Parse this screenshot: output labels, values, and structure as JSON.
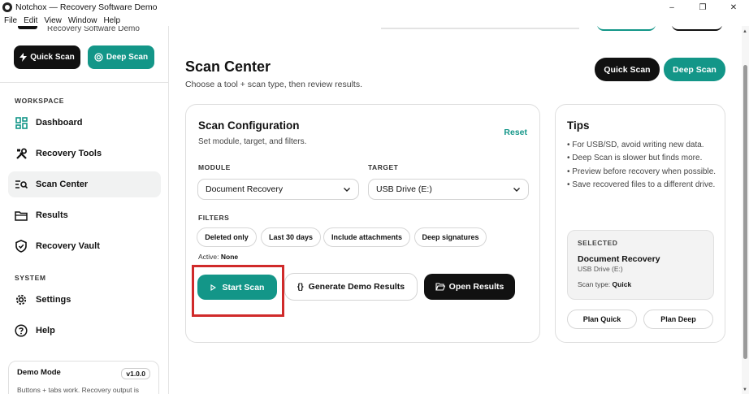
{
  "window": {
    "title": "Notchox — Recovery Software Demo",
    "controls": [
      "–",
      "❐",
      "✕"
    ]
  },
  "menu": [
    "File",
    "Edit",
    "View",
    "Window",
    "Help"
  ],
  "sidebar": {
    "brand_sub": "Recovery Software Demo",
    "quick_label": "Quick Scan",
    "deep_label": "Deep Scan",
    "workspace_label": "WORKSPACE",
    "system_label": "SYSTEM",
    "workspace_items": [
      {
        "label": "Dashboard",
        "icon": "dashboard-icon"
      },
      {
        "label": "Recovery Tools",
        "icon": "tools-icon"
      },
      {
        "label": "Scan Center",
        "icon": "scan-icon",
        "active": true
      },
      {
        "label": "Results",
        "icon": "folder-icon"
      },
      {
        "label": "Recovery Vault",
        "icon": "shield-icon"
      }
    ],
    "system_items": [
      {
        "label": "Settings",
        "icon": "gear-icon"
      },
      {
        "label": "Help",
        "icon": "help-icon"
      }
    ],
    "demo": {
      "title": "Demo Mode",
      "version": "v1.0.0",
      "text": "Buttons + tabs work. Recovery output is"
    }
  },
  "header": {
    "title": "Scan Center",
    "subtitle": "Choose a tool + scan type, then review results.",
    "quick_label": "Quick Scan",
    "deep_label": "Deep Scan"
  },
  "config": {
    "title": "Scan Configuration",
    "subtitle": "Set module, target, and filters.",
    "reset_label": "Reset",
    "module_label": "MODULE",
    "module_value": "Document Recovery",
    "target_label": "TARGET",
    "target_value": "USB Drive (E:)",
    "filters_label": "FILTERS",
    "filters": [
      "Deleted only",
      "Last 30 days",
      "Include attachments",
      "Deep signatures"
    ],
    "active_prefix": "Active:",
    "active_value": "None",
    "start_label": "Start Scan",
    "demo_results_label": "Generate Demo Results",
    "open_results_label": "Open Results"
  },
  "tips": {
    "title": "Tips",
    "items": [
      "For USB/SD, avoid writing new data.",
      "Deep Scan is slower but finds more.",
      "Preview before recovery when possible.",
      "Save recovered files to a different drive."
    ],
    "selected_label": "SELECTED",
    "selected_name": "Document Recovery",
    "selected_target": "USB Drive (E:)",
    "scan_type_prefix": "Scan type:",
    "scan_type_value": "Quick",
    "plan_quick_label": "Plan Quick",
    "plan_deep_label": "Plan Deep"
  },
  "colors": {
    "accent": "#139688",
    "dark": "#111111",
    "highlight": "#d02a2a"
  }
}
